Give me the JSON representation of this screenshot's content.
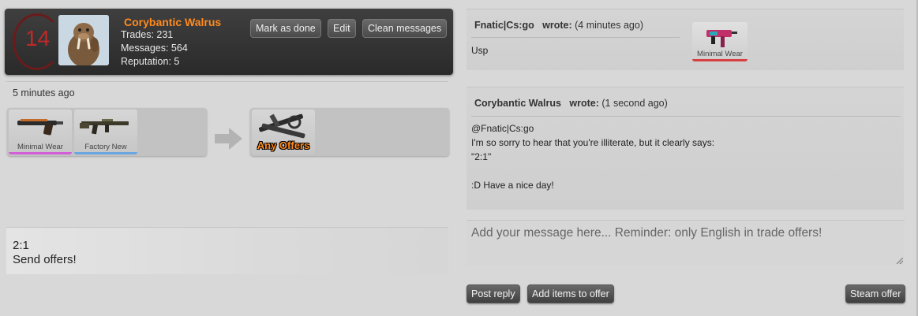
{
  "user": {
    "reputation_badge": "14",
    "name": "Corybantic Walrus",
    "trades": "Trades: 231",
    "messages": "Messages: 564",
    "reputation": "Reputation: 5"
  },
  "header_actions": {
    "mark_done": "Mark as done",
    "edit": "Edit",
    "clean": "Clean messages"
  },
  "trade": {
    "time_ago": "5 minutes ago",
    "offered_items": [
      {
        "label": "Minimal Wear",
        "bar_color": "#d25fd8"
      },
      {
        "label": "Factory New",
        "bar_color": "#6aa6e0"
      }
    ],
    "wanted_label": "Any Offers",
    "note_line1": "2:1",
    "note_line2": "Send offers!"
  },
  "messages": [
    {
      "author": "Fnatic|Cs:go",
      "wrote": "wrote:",
      "time": "(4 minutes ago)",
      "body": [
        "Usp"
      ],
      "item_label": "Minimal Wear",
      "item_bar": "#d64040"
    },
    {
      "author": "Corybantic Walrus",
      "wrote": "wrote:",
      "time": "(1 second ago)",
      "body": [
        "@Fnatic|Cs:go",
        "I'm so sorry to hear that you're illiterate, but it clearly says:",
        "\"2:1\"",
        "",
        ":D Have a nice day!"
      ]
    }
  ],
  "reply": {
    "placeholder": "Add your message here... Reminder: only English in trade offers!",
    "post": "Post reply",
    "add_items": "Add items to offer",
    "steam": "Steam offer"
  },
  "colors": {
    "username": "#ff8a1e",
    "reputation_badge": "#c32727",
    "header_bg": "#333333",
    "page_bg": "#d8d8d8"
  }
}
